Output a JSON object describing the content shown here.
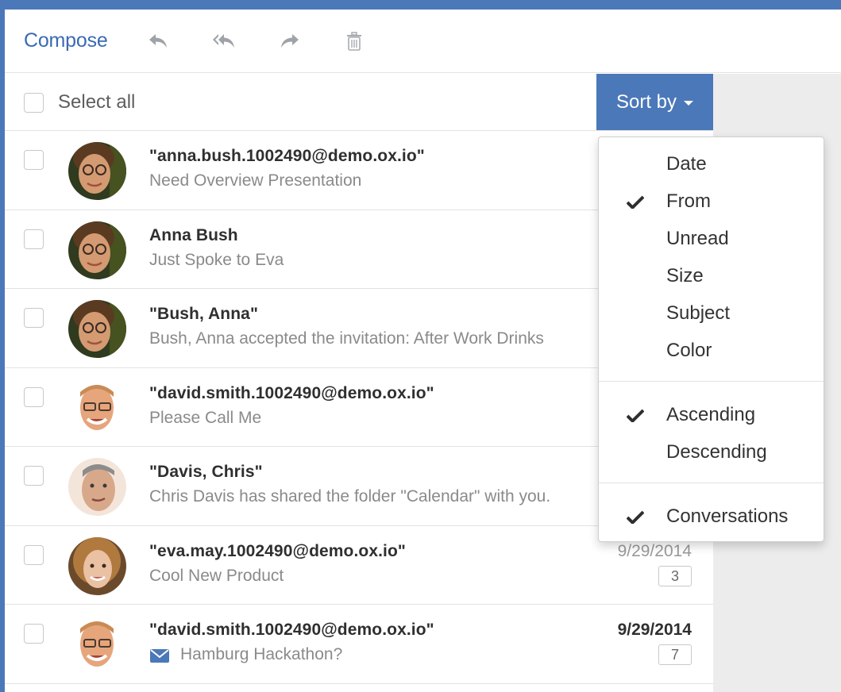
{
  "toolbar": {
    "compose_label": "Compose",
    "icons": [
      "reply-icon",
      "reply-all-icon",
      "forward-icon",
      "trash-icon"
    ]
  },
  "list_header": {
    "select_all_label": "Select all",
    "sort_button_label": "Sort by"
  },
  "emails": [
    {
      "sender": "\"anna.bush.1002490@demo.ox.io\"",
      "subject": "Need Overview Presentation",
      "date": "",
      "count": "",
      "unread": false,
      "avatar": "anna"
    },
    {
      "sender": "Anna Bush",
      "subject": "Just Spoke to Eva",
      "date": "",
      "count": "",
      "unread": false,
      "avatar": "anna"
    },
    {
      "sender": "\"Bush, Anna\"",
      "subject": "Bush, Anna accepted the invitation: After Work Drinks",
      "date": "",
      "count": "",
      "unread": false,
      "avatar": "anna"
    },
    {
      "sender": "\"david.smith.1002490@demo.ox.io\"",
      "subject": "Please Call Me",
      "date": "",
      "count": "",
      "unread": false,
      "avatar": "david"
    },
    {
      "sender": "\"Davis, Chris\"",
      "subject": "Chris Davis has shared the folder \"Calendar\" with you.",
      "date": "",
      "count": "",
      "unread": false,
      "avatar": "chris"
    },
    {
      "sender": "\"eva.may.1002490@demo.ox.io\"",
      "subject": "Cool New Product",
      "date": "9/29/2014",
      "count": "3",
      "unread": false,
      "avatar": "eva"
    },
    {
      "sender": "\"david.smith.1002490@demo.ox.io\"",
      "subject": "Hamburg Hackathon?",
      "date": "9/29/2014",
      "count": "7",
      "unread": true,
      "avatar": "david"
    }
  ],
  "sort_menu": {
    "fields": [
      {
        "label": "Date",
        "checked": false
      },
      {
        "label": "From",
        "checked": true
      },
      {
        "label": "Unread",
        "checked": false
      },
      {
        "label": "Size",
        "checked": false
      },
      {
        "label": "Subject",
        "checked": false
      },
      {
        "label": "Color",
        "checked": false
      }
    ],
    "order": [
      {
        "label": "Ascending",
        "checked": true
      },
      {
        "label": "Descending",
        "checked": false
      }
    ],
    "options": [
      {
        "label": "Conversations",
        "checked": true
      }
    ]
  },
  "colors": {
    "accent": "#4b78b9",
    "link": "#3a6ab3",
    "panel": "#ececec"
  }
}
